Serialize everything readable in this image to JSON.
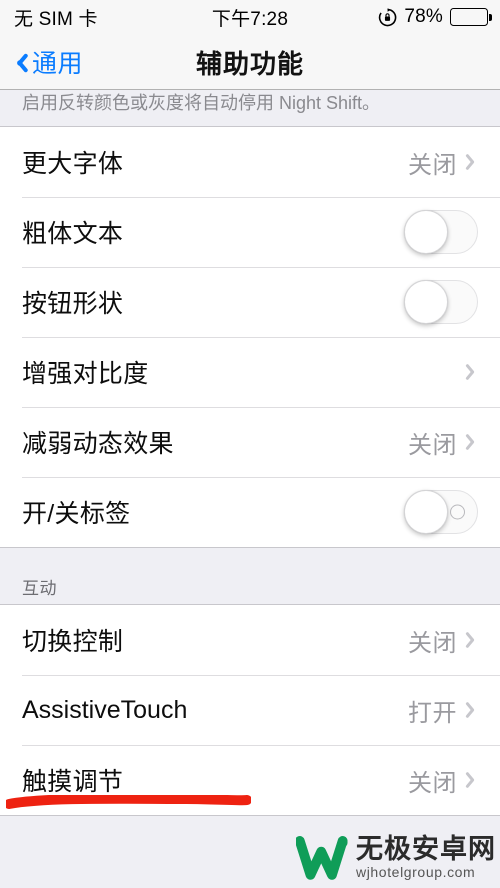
{
  "status_bar": {
    "carrier": "无 SIM 卡",
    "time": "下午7:28",
    "rotation_lock_icon": "rotation-lock-icon",
    "battery_percent": "78%",
    "battery_level": 78
  },
  "nav": {
    "back_label": "通用",
    "back_icon": "chevron-left-icon",
    "title": "辅助功能"
  },
  "sections": {
    "footer_note": "启用反转颜色或灰度将自动停用 Night Shift。",
    "vision_rows": [
      {
        "label": "更大字体",
        "value": "关闭",
        "control": "disclosure"
      },
      {
        "label": "粗体文本",
        "value": "",
        "control": "switch-off"
      },
      {
        "label": "按钮形状",
        "value": "",
        "control": "switch-off"
      },
      {
        "label": "增强对比度",
        "value": "",
        "control": "disclosure"
      },
      {
        "label": "减弱动态效果",
        "value": "关闭",
        "control": "disclosure"
      },
      {
        "label": "开/关标签",
        "value": "",
        "control": "switch-off-labeled"
      }
    ],
    "interaction_header": "互动",
    "interaction_rows": [
      {
        "label": "切换控制",
        "value": "关闭",
        "control": "disclosure"
      },
      {
        "label": "AssistiveTouch",
        "value": "打开",
        "control": "disclosure"
      },
      {
        "label": "触摸调节",
        "value": "关闭",
        "control": "disclosure"
      }
    ]
  },
  "annotation": {
    "type": "red-underline",
    "color": "#ee2211"
  },
  "watermark": {
    "title": "无极安卓网",
    "subtitle": "wjhotelgroup.com",
    "logo_color": "#0f9d58"
  },
  "colors": {
    "accent_blue": "#0a7cff",
    "background": "#efeff4",
    "card": "#ffffff",
    "separator": "#c8c7cc",
    "secondary_text": "#8a8a8f"
  }
}
